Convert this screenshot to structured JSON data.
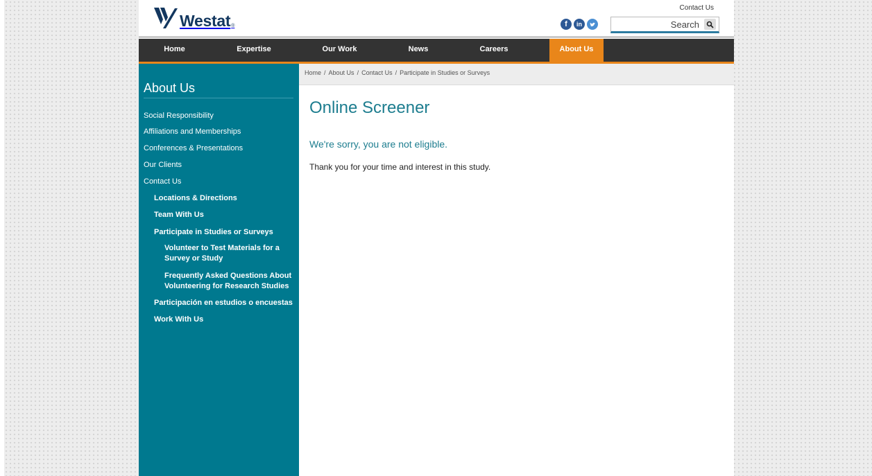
{
  "header": {
    "logo_text": "Westat",
    "logo_mark": "®",
    "contact_link": "Contact Us",
    "search_placeholder": "Search"
  },
  "social": [
    {
      "icon": "facebook-icon",
      "glyph": "f"
    },
    {
      "icon": "linkedin-icon",
      "glyph": "in"
    },
    {
      "icon": "twitter-icon",
      "glyph": "t"
    }
  ],
  "nav": {
    "items": [
      "Home",
      "Expertise",
      "Our Work",
      "News",
      "Careers",
      "About Us"
    ],
    "active": "About Us"
  },
  "sidebar": {
    "title": "About Us",
    "items": [
      {
        "label": "Social Responsibility",
        "level": 1
      },
      {
        "label": "Affiliations and Memberships",
        "level": 1
      },
      {
        "label": "Conferences & Presentations",
        "level": 1
      },
      {
        "label": "Our Clients",
        "level": 1
      },
      {
        "label": "Contact Us",
        "level": 1
      },
      {
        "label": "Locations & Directions",
        "level": 2
      },
      {
        "label": "Team With Us",
        "level": 2
      },
      {
        "label": "Participate in Studies or Surveys",
        "level": 2
      },
      {
        "label": "Volunteer to Test Materials for a Survey or Study",
        "level": 3
      },
      {
        "label": "Frequently Asked Questions About Volunteering for Research Studies",
        "level": 3
      },
      {
        "label": "Participación en estudios o encuestas",
        "level": 2
      },
      {
        "label": "Work With Us",
        "level": 2
      }
    ]
  },
  "breadcrumb": [
    "Home",
    "About Us",
    "Contact Us",
    "Participate in Studies or Surveys"
  ],
  "breadcrumb_separator": "/",
  "content": {
    "title": "Online Screener",
    "subtitle": "We're sorry, you are not eligible.",
    "body": "Thank you for your time and interest in this study."
  },
  "colors": {
    "brand_navy": "#13375f",
    "teal": "#00798f",
    "orange": "#e9861a",
    "nav_dark": "#333333"
  }
}
